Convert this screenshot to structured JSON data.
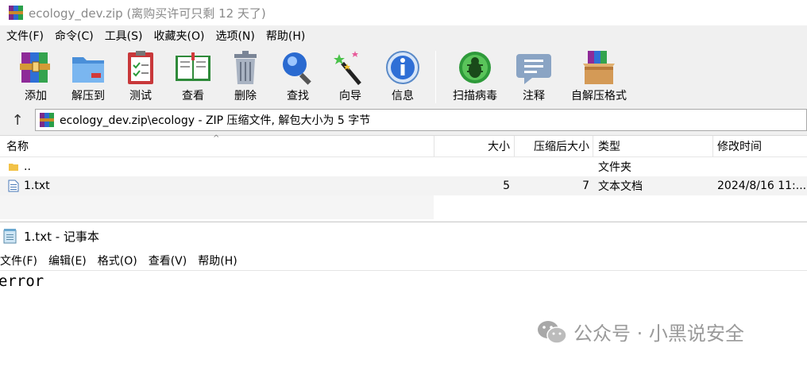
{
  "rar_window": {
    "title": "ecology_dev.zip (离购买许可只剩 12 天了)",
    "menu": [
      "文件(F)",
      "命令(C)",
      "工具(S)",
      "收藏夹(O)",
      "选项(N)",
      "帮助(H)"
    ],
    "toolbar": {
      "add": "添加",
      "extract": "解压到",
      "test": "测试",
      "view": "查看",
      "delete": "删除",
      "find": "查找",
      "wizard": "向导",
      "info": "信息",
      "virus_scan": "扫描病毒",
      "comment": "注释",
      "sfx": "自解压格式"
    },
    "address": "ecology_dev.zip\\ecology - ZIP 压缩文件, 解包大小为 5 字节",
    "columns": {
      "name": "名称",
      "size": "大小",
      "packed": "压缩后大小",
      "type": "类型",
      "modified": "修改时间"
    },
    "rows": [
      {
        "name": "..",
        "size": "",
        "packed": "",
        "type": "文件夹",
        "modified": ""
      },
      {
        "name": "1.txt",
        "size": "5",
        "packed": "7",
        "type": "文本文档",
        "modified": "2024/8/16 11:..."
      }
    ]
  },
  "notepad": {
    "title": "1.txt - 记事本",
    "menu": [
      "文件(F)",
      "编辑(E)",
      "格式(O)",
      "查看(V)",
      "帮助(H)"
    ],
    "content": "error"
  },
  "watermark": "公众号 · 小黑说安全"
}
